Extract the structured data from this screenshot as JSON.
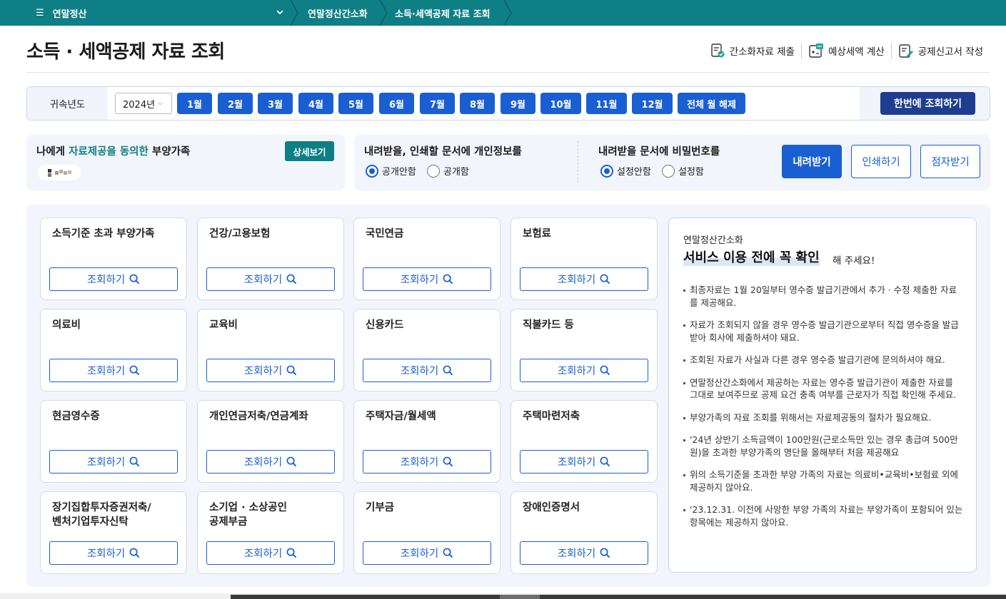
{
  "topnav": {
    "menu_label": "연말정산",
    "breadcrumbs": [
      "연말정산간소화",
      "소득·세액공제 자료 조회"
    ]
  },
  "header": {
    "title": "소득 · 세액공제 자료 조회",
    "links": [
      {
        "label": "간소화자료 제출",
        "icon": "document-check-icon"
      },
      {
        "label": "예상세액 계산",
        "icon": "calculator-icon"
      },
      {
        "label": "공제신고서 작성",
        "icon": "form-edit-icon"
      }
    ]
  },
  "year_bar": {
    "label": "귀속년도",
    "selected_year": "2024년",
    "months": [
      "1월",
      "2월",
      "3월",
      "4월",
      "5월",
      "6월",
      "7월",
      "8월",
      "9월",
      "10월",
      "11월",
      "12월"
    ],
    "clear_all": "전체 월 해제",
    "query_all": "한번에 조회하기"
  },
  "dependents": {
    "title_pre": "나에게 ",
    "title_hl": "자료제공을 동의한",
    "title_post": " 부양가족",
    "detail_button": "상세보기"
  },
  "privacy": {
    "title": "내려받을, 인쇄할 문서에 개인정보를",
    "options": [
      "공개안함",
      "공개함"
    ],
    "selected": "공개안함"
  },
  "password": {
    "title": "내려받을 문서에 비밀번호를",
    "options": [
      "설정안함",
      "설정함"
    ],
    "selected": "설정안함"
  },
  "actions": {
    "download": "내려받기",
    "print": "인쇄하기",
    "braille": "점자받기"
  },
  "cards": [
    {
      "title": "소득기준 초과 부양가족"
    },
    {
      "title": "건강/고용보험"
    },
    {
      "title": "국민연금"
    },
    {
      "title": "보험료"
    },
    {
      "title": "의료비"
    },
    {
      "title": "교육비"
    },
    {
      "title": "신용카드"
    },
    {
      "title": "직불카드 등"
    },
    {
      "title": "현금영수증"
    },
    {
      "title": "개인연금저축/연금계좌"
    },
    {
      "title": "주택자금/월세액"
    },
    {
      "title": "주택마련저축"
    },
    {
      "title": "장기집합투자증권저축/\n벤처기업투자신탁"
    },
    {
      "title": "소기업 · 소상공인\n공제부금"
    },
    {
      "title": "기부금"
    },
    {
      "title": "장애인증명서"
    }
  ],
  "card_button": "조회하기",
  "notice": {
    "subtitle": "연말정산간소화",
    "heading": "서비스 이용 전에 꼭 확인",
    "heading_tail": "해 주세요!",
    "items": [
      "최종자료는 1월 20일부터 영수증 발급기관에서 추가 · 수정 제출한 자료를 제공해요.",
      "자료가 조회되지 않을 경우 영수증 발급기관으로부터 직접 영수증을 발급받아 회사에 제출하셔야 돼요.",
      "조회된 자료가 사실과 다른 경우 영수증 발급기관에 문의하셔야 해요.",
      "연말정산간소화에서 제공하는 자료는 영수증 발급기관이 제출한 자료를 그대로 보여주므로 공제 요건 충족 여부를 근로자가 직접 확인해 주세요.",
      "부양가족의 자료 조회를 위해서는 자료제공동의 절차가 필요해요.",
      "'24년 상반기 소득금액이 100만원(근로소득만 있는 경우 총급여 500만원)을 초과한 부양가족의 명단을 올해부터 처음 제공해요",
      "위의 소득기준을 초과한 부양 가족의 자료는 의료비•교육비•보험료 외에 제공하지 않아요.",
      "'23.12.31. 이전에 사망한 부양 가족의 자료는 부양가족이 포함되어 있는 항목에는 제공하지 않아요."
    ]
  },
  "colors": {
    "brand_teal": "#0e7f84",
    "primary_blue": "#1a5fd1",
    "navy": "#1e3d8f"
  }
}
